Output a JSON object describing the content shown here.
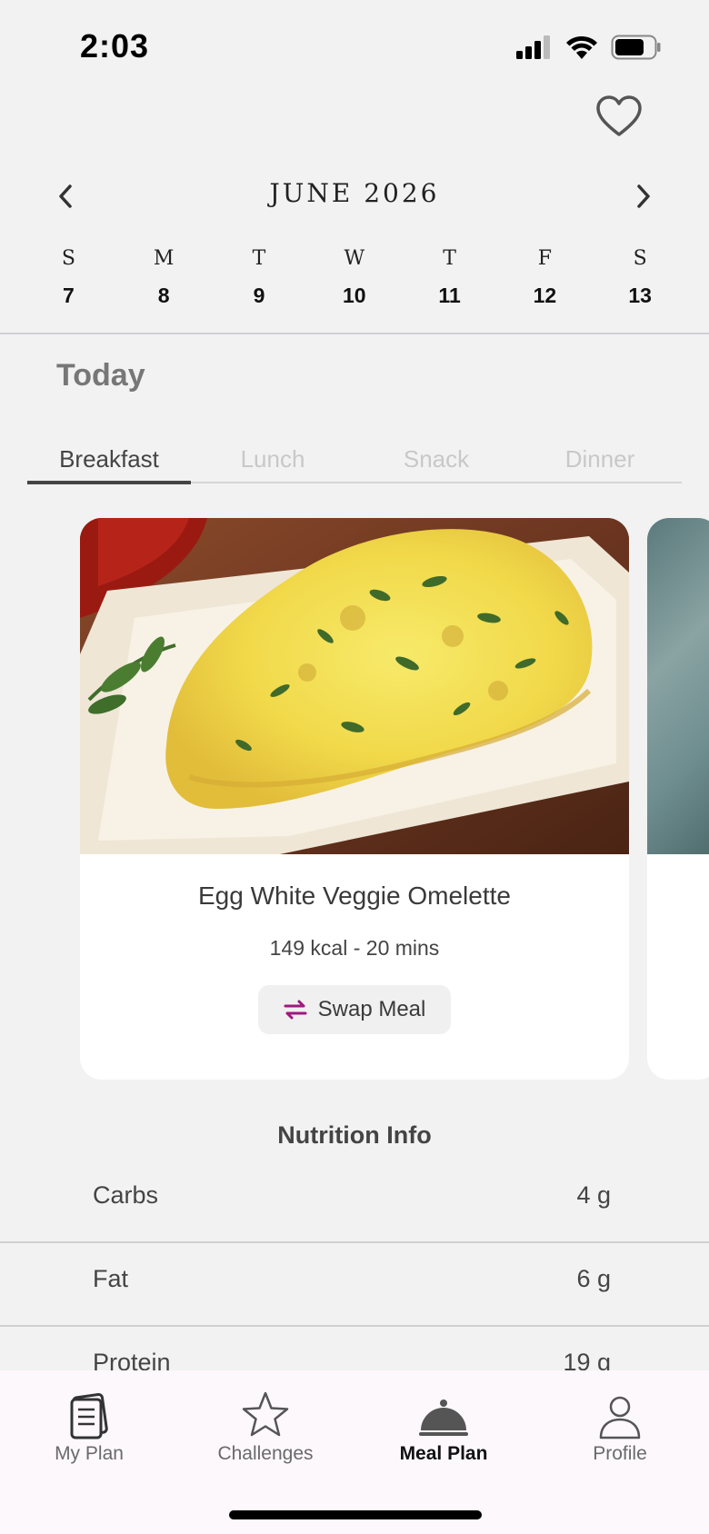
{
  "status": {
    "time": "2:03"
  },
  "calendar": {
    "month_label": "JUNE 2026",
    "days": [
      {
        "letter": "S",
        "num": "7"
      },
      {
        "letter": "M",
        "num": "8"
      },
      {
        "letter": "T",
        "num": "9"
      },
      {
        "letter": "W",
        "num": "10"
      },
      {
        "letter": "T",
        "num": "11"
      },
      {
        "letter": "F",
        "num": "12"
      },
      {
        "letter": "S",
        "num": "13"
      }
    ]
  },
  "day_title": "Today",
  "meal_tabs": [
    "Breakfast",
    "Lunch",
    "Snack",
    "Dinner"
  ],
  "active_meal_tab": "Breakfast",
  "meal": {
    "title": "Egg White Veggie Omelette",
    "meta": "149 kcal - 20 mins",
    "swap_label": "Swap Meal"
  },
  "nutrition": {
    "title": "Nutrition Info",
    "rows": [
      {
        "label": "Carbs",
        "value": "4 g"
      },
      {
        "label": "Fat",
        "value": "6 g"
      },
      {
        "label": "Protein",
        "value": "19 g"
      }
    ]
  },
  "tabbar": [
    {
      "label": "My Plan",
      "icon": "document-icon"
    },
    {
      "label": "Challenges",
      "icon": "star-icon"
    },
    {
      "label": "Meal Plan",
      "icon": "cloche-icon"
    },
    {
      "label": "Profile",
      "icon": "person-icon"
    }
  ],
  "colors": {
    "accent": "#a0187f",
    "background": "#f2f2f2",
    "tabbar_bg": "#fdf8fc"
  }
}
